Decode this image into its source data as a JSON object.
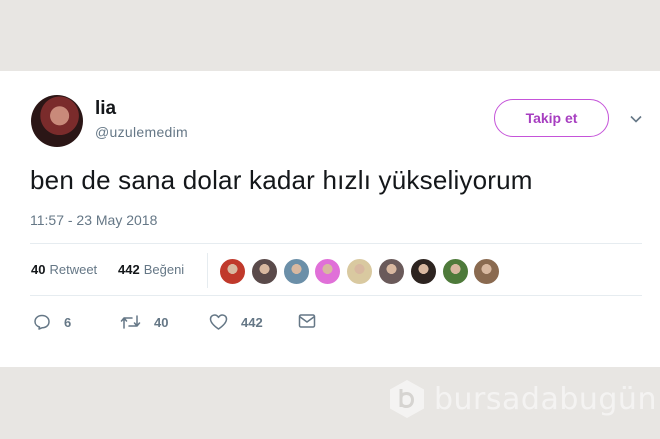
{
  "tweet": {
    "display_name": "lia",
    "handle": "@uzulemedim",
    "text": "ben de sana dolar kadar hızlı yükseliyorum",
    "timestamp": "11:57 - 23 May 2018",
    "follow_label": "Takip et"
  },
  "stats": {
    "retweets_count": "40",
    "retweets_label": "Retweet",
    "likes_count": "442",
    "likes_label": "Beğeni"
  },
  "likers": [
    {
      "color": "#c0392b"
    },
    {
      "color": "#5a4a4a"
    },
    {
      "color": "#6b8fa8"
    },
    {
      "color": "#e070d8"
    },
    {
      "color": "#d9c9a0"
    },
    {
      "color": "#6a5a5a"
    },
    {
      "color": "#2d2420"
    },
    {
      "color": "#4e7a3a"
    },
    {
      "color": "#8a6a50"
    }
  ],
  "actions": {
    "replies": "6",
    "retweets": "40",
    "likes": "442"
  },
  "watermark": {
    "text": "bursadabugün"
  },
  "colors": {
    "accent": "#a73ec0",
    "text": "#14171a",
    "muted": "#657786",
    "background": "#e8e6e3"
  }
}
